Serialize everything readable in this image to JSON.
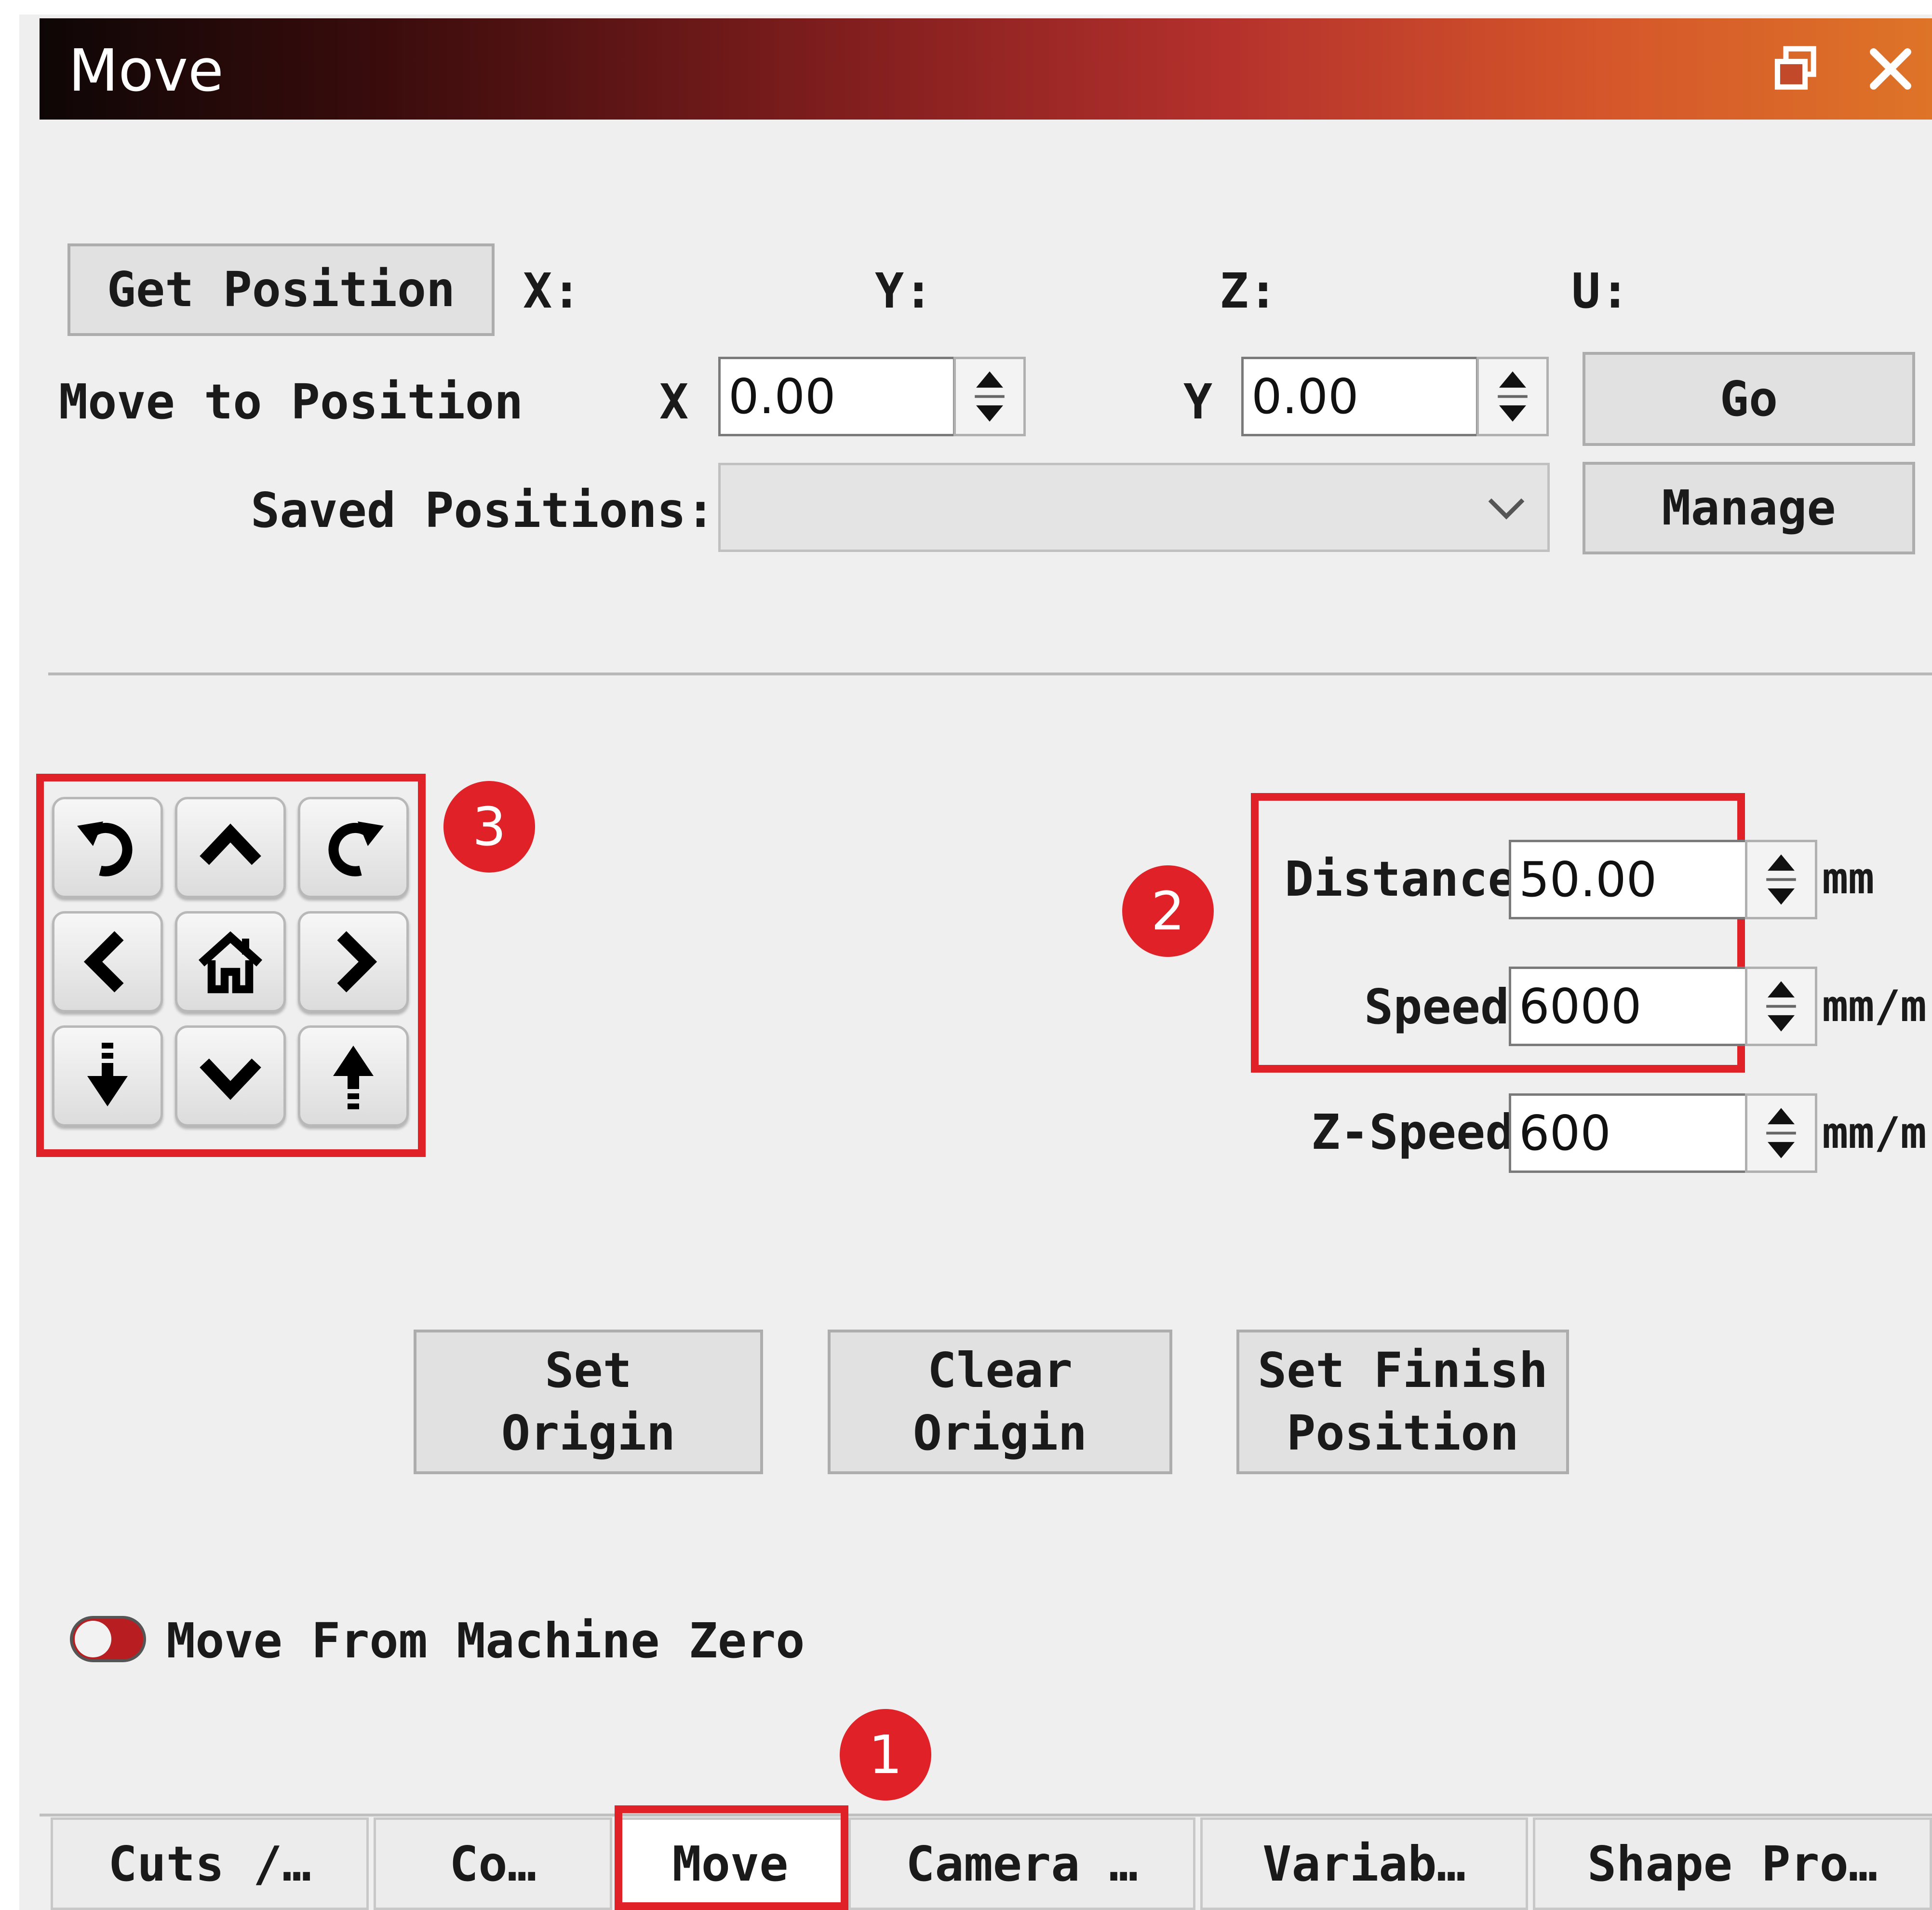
{
  "window": {
    "title": "Move",
    "restore_icon": "restore-icon",
    "close_icon": "close-icon",
    "title_gradient": [
      "#0e0606",
      "#7a1c1c",
      "#b3302c",
      "#de7428"
    ]
  },
  "position": {
    "get_position_label": "Get Position",
    "x_label": "X:",
    "y_label": "Y:",
    "z_label": "Z:",
    "u_label": "U:"
  },
  "move_to": {
    "label": "Move to Position",
    "x_axis": "X",
    "x_value": "0.00",
    "y_axis": "Y",
    "y_value": "0.00",
    "go_label": "Go"
  },
  "saved": {
    "label": "Saved Positions:",
    "selected": "",
    "manage_label": "Manage"
  },
  "jog": {
    "buttons": [
      {
        "icon": "rotate-ccw-icon"
      },
      {
        "icon": "arrow-up-icon"
      },
      {
        "icon": "rotate-cw-icon"
      },
      {
        "icon": "arrow-left-icon"
      },
      {
        "icon": "home-icon"
      },
      {
        "icon": "arrow-right-icon"
      },
      {
        "icon": "z-down-icon"
      },
      {
        "icon": "arrow-down-icon"
      },
      {
        "icon": "z-up-icon"
      }
    ]
  },
  "settings": {
    "distance_label": "Distance",
    "distance_value": "50.00",
    "distance_unit": "mm",
    "speed_label": "Speed",
    "speed_value": "6000",
    "speed_unit": "mm/m",
    "zspeed_label": "Z-Speed",
    "zspeed_value": "600",
    "zspeed_unit": "mm/m"
  },
  "actions": {
    "set_origin_line1": "Set",
    "set_origin_line2": "Origin",
    "clear_origin_line1": "Clear",
    "clear_origin_line2": "Origin",
    "set_finish_line1": "Set Finish",
    "set_finish_line2": "Position"
  },
  "toggle": {
    "label": "Move From Machine Zero",
    "on": false,
    "accent": "#b81d22"
  },
  "tabs": [
    "Cuts /…",
    "Co…",
    "Move",
    "Camera …",
    "Variab…",
    "Shape Pro…"
  ],
  "annotations": {
    "badge_1": "1",
    "badge_2": "2",
    "badge_3": "3",
    "color": "#e02128"
  }
}
